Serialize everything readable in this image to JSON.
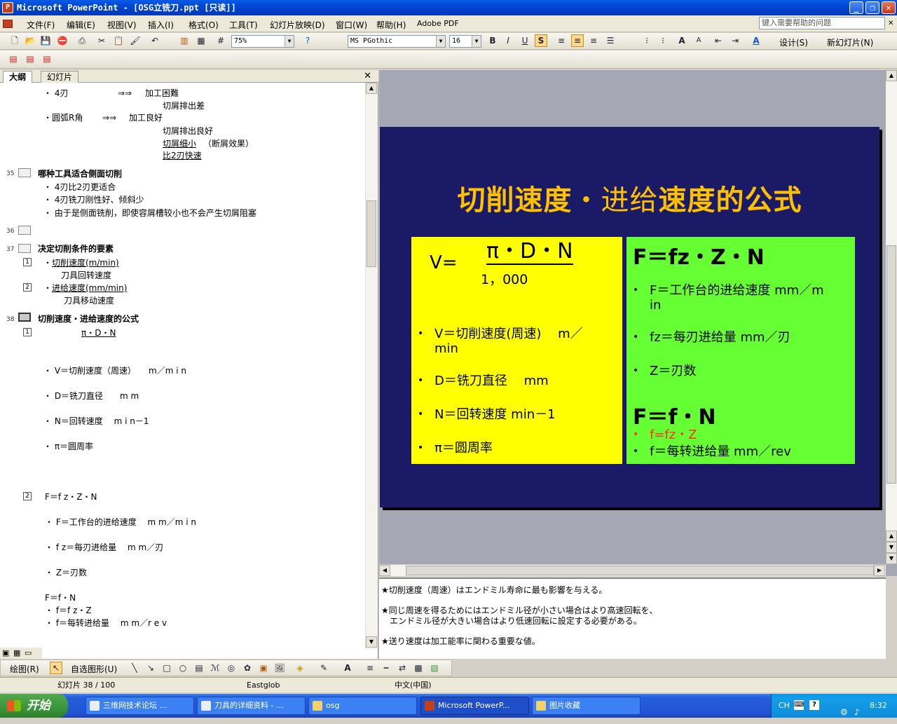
{
  "window": {
    "title": "Microsoft PowerPoint - [OSG立铣刀.ppt [只读]]"
  },
  "menu": {
    "items": [
      "文件(F)",
      "编辑(E)",
      "视图(V)",
      "插入(I)",
      "格式(O)",
      "工具(T)",
      "幻灯片放映(D)",
      "窗口(W)",
      "帮助(H)",
      "Adobe PDF"
    ],
    "help_placeholder": "键入需要帮助的问题"
  },
  "toolbar": {
    "zoom": "75%",
    "font": "MS PGothic",
    "font_size": "16",
    "design": "设计(S)",
    "new_slide": "新幻灯片(N)"
  },
  "outline_pane": {
    "tabs": [
      "大纲",
      "幻灯片"
    ],
    "lines": {
      "l1a": "・ 4刃",
      "l1b": "⇒⇒",
      "l1c": "加工困難",
      "l2": "切屑排出差",
      "l3a": "・圆弧R角",
      "l3b": "⇒⇒",
      "l3c": "加工良好",
      "l4": "切屑排出良好",
      "l5a": "切屑细小",
      "l5b": "（断屑效果）",
      "l6": "比2刃快速",
      "s35": "35",
      "t35": "哪种工具适合侧面切削",
      "b35_1": "・   4刃比2刃更适合",
      "b35_2": "・   4刃铣刀刚性好、倾斜少",
      "b35_3": "・   由于是侧面铣削，即使容屑槽较小也不会产生切屑阻塞",
      "s36": "36",
      "s37": "37",
      "t37": "决定切削条件的要素",
      "n1": "1",
      "b37_1": "切削速度(m/min)",
      "b37_1b": "刀具回转速度",
      "n2": "2",
      "b37_2": "进给速度(mm/min)",
      "b37_2b": "刀具移动速度",
      "s38": "38",
      "t38": "切削速度・进给速度的公式",
      "n38a": "1",
      "f38": "π・D・N",
      "v1": "・ V＝切削速度（周速）　　m／m i n",
      "v2": "・ D＝铣刀直径　　m m",
      "v3": "・ N＝回转速度　 m i n－1",
      "v4": "・ π＝圆周率",
      "n38b": "2",
      "f2": "F＝f z・Z・N",
      "g1": "・ F＝工作台的进给速度　 m m／m i n",
      "g2": "・ f z＝每刃进给量　 m m／刃",
      "g3": "・ Z＝刃数",
      "h0": "F＝f・N",
      "h1": "・ f＝f z・Z",
      "h2": "・ f＝每转进给量　 m m／r e v"
    }
  },
  "slide": {
    "title_a": "切削速度",
    "title_b": "・进给",
    "title_c": "速度的公式",
    "formula_v": "V=",
    "formula_num": "π・D・N",
    "formula_den": "1，000",
    "y1": "V＝切削速度(周速)　 m／",
    "y1b": "min",
    "y2": "D＝铣刀直径　 mm",
    "y3": "N＝回转速度  min－1",
    "y4": "π＝圆周率",
    "g_title": "F＝fz・Z・N",
    "g1": "F＝工作台的进给速度  mm／m",
    "g1b": "in",
    "g2": "fz＝每刃进给量  mm／刃",
    "g3": "Z＝刃数",
    "g_title2": "F＝f・N",
    "g4": "f=fz・Z",
    "g5": "f＝每转进给量  mm／rev",
    "bullet": "•"
  },
  "notes": {
    "lines": [
      "★切削速度（周速）はエンドミル寿命に最も影響を与える。",
      "★同じ周速を得るためにはエンドミル径が小さい場合はより高速回転を、\n　エンドミル径が大きい場合はより低速回転に設定する必要がある。",
      "★送り速度は加工能率に関わる重要な値。"
    ]
  },
  "drawbar": {
    "draw": "绘图(R)",
    "autoshape": "自选图形(U)"
  },
  "status": {
    "slide": "幻灯片 38 / 100",
    "design": "Eastglob",
    "lang": "中文(中国)"
  },
  "taskbar": {
    "start": "开始",
    "tasks": [
      "三维网技术论坛 ...",
      "刀具的详细资料 - ...",
      "osg",
      "Microsoft PowerP...",
      "图片收藏"
    ],
    "ime": "CH",
    "time": "8:32"
  },
  "colors": {
    "slide_bg": "#1b1a66",
    "title": "#ffc000",
    "yellow_box": "#ffff00",
    "green_box": "#66ff33",
    "red_text": "#ff3300"
  }
}
